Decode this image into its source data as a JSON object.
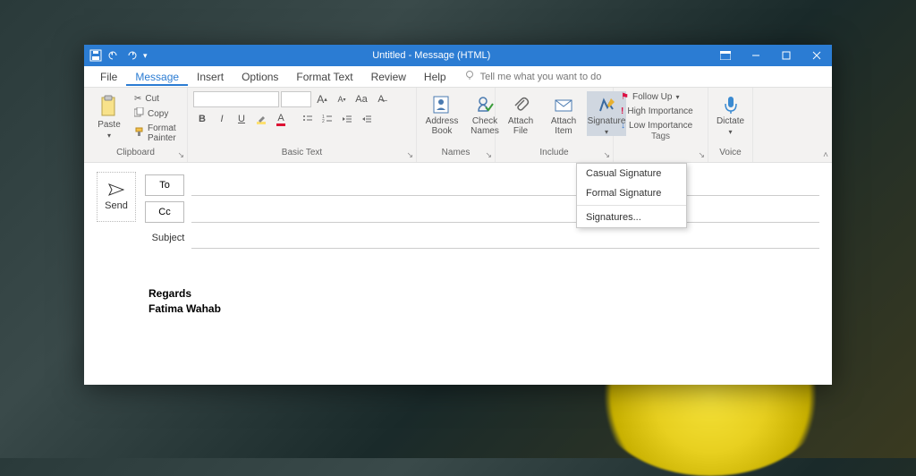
{
  "titlebar": {
    "title": "Untitled - Message (HTML)"
  },
  "tabs": {
    "items": [
      "File",
      "Message",
      "Insert",
      "Options",
      "Format Text",
      "Review",
      "Help"
    ],
    "active_index": 1,
    "tellme_placeholder": "Tell me what you want to do"
  },
  "ribbon": {
    "clipboard": {
      "label": "Clipboard",
      "paste": "Paste",
      "cut": "Cut",
      "copy": "Copy",
      "fmtpaint": "Format Painter"
    },
    "basic_text": {
      "label": "Basic Text"
    },
    "names": {
      "label": "Names",
      "address_book": "Address\nBook",
      "check_names": "Check\nNames"
    },
    "include": {
      "label": "Include",
      "attach_file": "Attach\nFile",
      "attach_item": "Attach\nItem",
      "signature": "Signature"
    },
    "tags": {
      "label": "Tags",
      "follow_up": "Follow Up",
      "high": "High Importance",
      "low": "Low Importance"
    },
    "voice": {
      "label": "Voice",
      "dictate": "Dictate"
    }
  },
  "signature_dropdown": {
    "items": [
      "Casual Signature",
      "Formal Signature"
    ],
    "more": "Signatures..."
  },
  "compose": {
    "send": "Send",
    "to": "To",
    "cc": "Cc",
    "subject_label": "Subject",
    "body_signature": [
      "Regards",
      "Fatima Wahab"
    ]
  }
}
